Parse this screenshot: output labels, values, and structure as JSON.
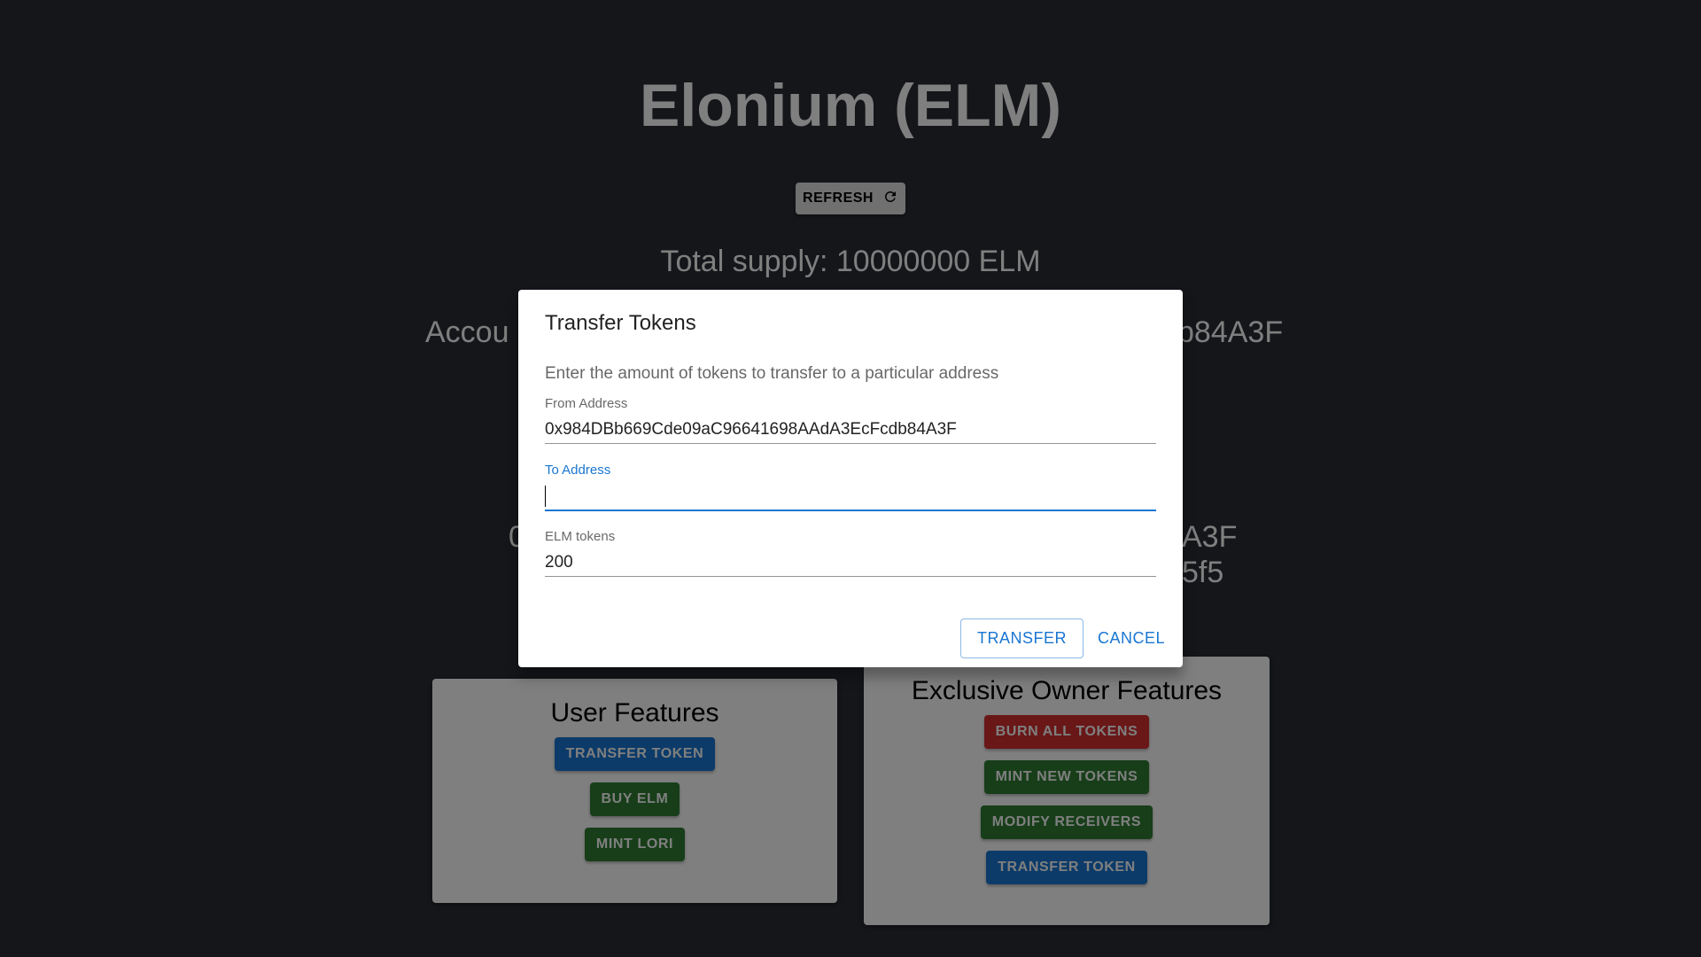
{
  "page": {
    "title": "Elonium (ELM)",
    "refresh_label": "REFRESH",
    "refresh_icon": "refresh-icon",
    "total_supply": "Total supply: 10000000 ELM",
    "account_left": "Accou",
    "account_right": "b84A3F",
    "owner_line1_left": "0",
    "owner_line1_right": "A3F",
    "owner_line2_right": "5f5"
  },
  "user_features": {
    "heading": "User Features",
    "buttons": [
      "TRANSFER TOKEN",
      "BUY ELM",
      "MINT LORI"
    ]
  },
  "owner_features": {
    "heading": "Exclusive Owner Features",
    "buttons": [
      "BURN ALL TOKENS",
      "MINT NEW TOKENS",
      "MODIFY RECEIVERS",
      "TRANSFER TOKEN"
    ]
  },
  "dialog": {
    "title": "Transfer Tokens",
    "description": "Enter the amount of tokens to transfer to a particular address",
    "from_label": "From Address",
    "from_value": "0x984DBb669Cde09aC96641698AAdA3EcFcdb84A3F",
    "to_label": "To Address",
    "to_value": "",
    "tokens_label": "ELM tokens",
    "tokens_value": "200",
    "transfer_label": "TRANSFER",
    "cancel_label": "CANCEL"
  },
  "colors": {
    "background": "#282c34",
    "primary": "#1976d2",
    "success": "#2e7d32",
    "danger": "#d32f2f"
  }
}
